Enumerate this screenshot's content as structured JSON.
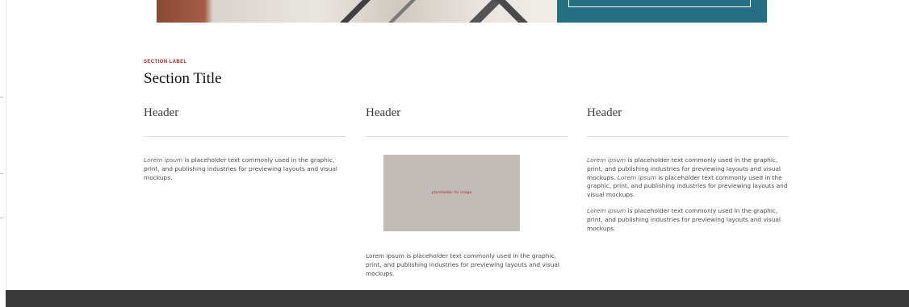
{
  "hero": {
    "photo_color": "#a55d44",
    "panel_color": "#256f82"
  },
  "section": {
    "label": "SECTION LABEL",
    "title": "Section Title",
    "label_color": "#b21f24"
  },
  "columns": [
    {
      "header": "Header",
      "paragraphs": [
        {
          "em": "Lorem ipsum",
          "text": " is placeholder text commonly used in the graphic, print, and publishing industries for previewing layouts and visual mockups."
        }
      ]
    },
    {
      "header": "Header",
      "image_placeholder": "placeholder for image",
      "paragraph": "Lorem ipsum is placeholder text commonly used in the graphic, print, and publishing industries for previewing layouts and visual mockups."
    },
    {
      "header": "Header",
      "paragraphs": [
        {
          "em": "Lorem ipsum",
          "text": " is placeholder text commonly used in the graphic, print, and publishing industries for previewing layouts and visual mockups. ",
          "em2": "Lorem ipsum",
          "text2": " is placeholder text commonly used in the graphic, print, and publishing industries for previewing layouts and visual mockups."
        },
        {
          "em": "Lorem ipsum",
          "text": " is placeholder text commonly used in the graphic, print, and publishing industries for previewing layouts and visual mockups."
        }
      ]
    }
  ],
  "footer": {
    "color": "#3a3a3a"
  }
}
